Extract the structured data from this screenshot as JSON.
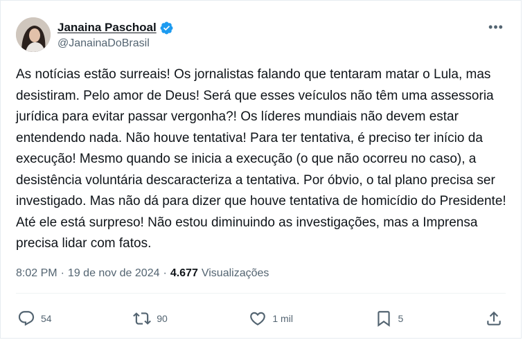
{
  "author": {
    "display_name": "Janaina Paschoal",
    "handle": "@JanainaDoBrasil",
    "verified": true
  },
  "menu": {
    "more_label": "•••"
  },
  "tweet": {
    "text": "As notícias estão surreais! Os jornalistas falando que tentaram matar o Lula, mas desistiram. Pelo amor de Deus! Será que esses veículos não têm uma assessoria jurídica para evitar passar vergonha?! Os líderes mundiais não devem estar entendendo nada. Não houve tentativa! Para ter tentativa, é preciso ter início da execução! Mesmo quando se inicia a execução (o que não ocorreu no caso), a desistência voluntária descaracteriza a tentativa. Por óbvio, o tal plano precisa ser investigado. Mas não dá para dizer que houve tentativa de homicídio do Presidente! Até ele está surpreso! Não estou diminuindo as investigações, mas a Imprensa precisa lidar com fatos."
  },
  "meta": {
    "time": "8:02 PM",
    "separator": "·",
    "date": "19 de nov de 2024",
    "views_count": "4.677",
    "views_label": "Visualizações"
  },
  "actions": {
    "replies": "54",
    "reposts": "90",
    "likes": "1 mil",
    "bookmarks": "5"
  },
  "colors": {
    "verified_blue": "#1d9bf0",
    "secondary_text": "#536471",
    "primary_text": "#0f1419"
  }
}
